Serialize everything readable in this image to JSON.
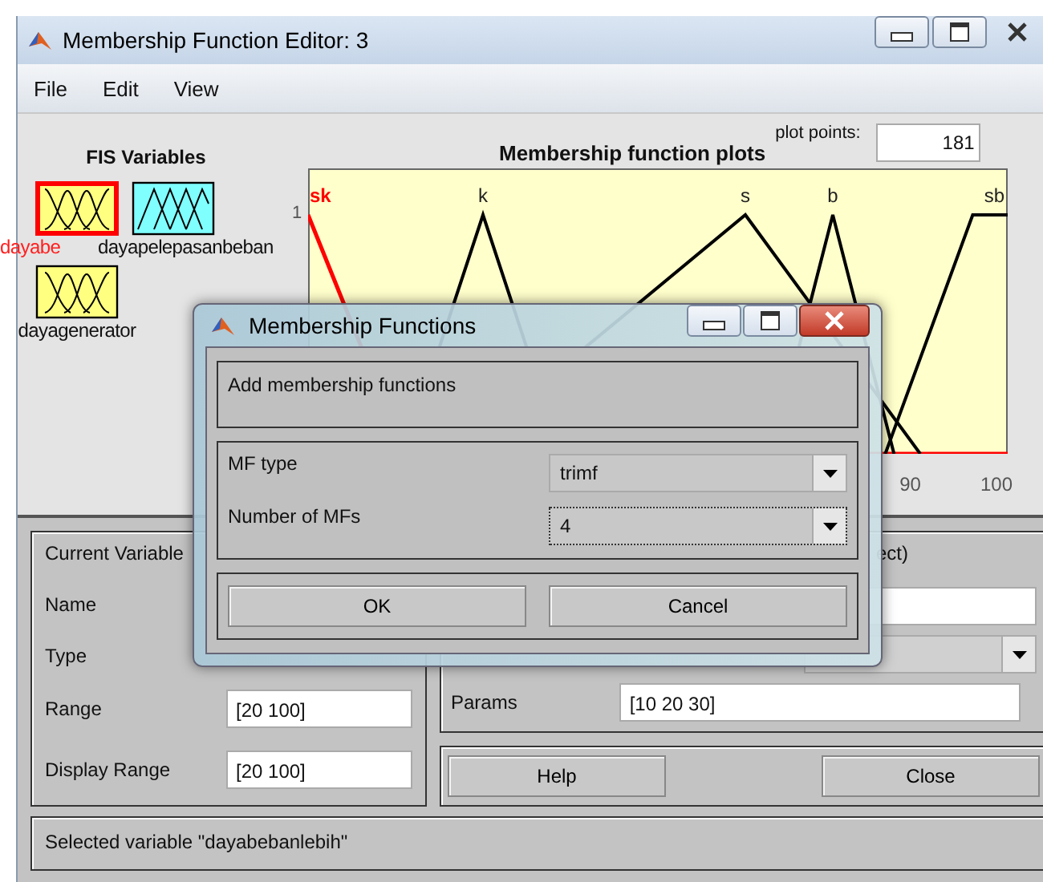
{
  "window": {
    "title": "Membership Function Editor: 3"
  },
  "menu": [
    "File",
    "Edit",
    "View"
  ],
  "fis_variables": {
    "title": "FIS Variables",
    "items": [
      {
        "name": "dayabe",
        "kind": "input",
        "selected": true
      },
      {
        "name": "dayapelepasanbeban",
        "kind": "output",
        "selected": false
      },
      {
        "name": "dayagenerator",
        "kind": "input",
        "selected": false
      }
    ]
  },
  "plot": {
    "title": "Membership function plots",
    "plot_points_label": "plot points:",
    "plot_points": "181",
    "y_tick": "1",
    "x_ticks": [
      "90",
      "100"
    ],
    "mfs": [
      {
        "name": "sk",
        "selected": true
      },
      {
        "name": "k",
        "selected": false
      },
      {
        "name": "s",
        "selected": false
      },
      {
        "name": "b",
        "selected": false
      },
      {
        "name": "sb",
        "selected": false
      }
    ]
  },
  "current_variable": {
    "title": "Current Variable",
    "name_label": "Name",
    "type_label": "Type",
    "range_label": "Range",
    "range": "[20 100]",
    "display_range_label": "Display Range",
    "display_range": "[20 100]"
  },
  "current_mf": {
    "title_fragment": "ect)",
    "params_label": "Params",
    "params": "[10 20 30]"
  },
  "buttons": [
    "Help",
    "Close"
  ],
  "status": "Selected variable \"dayabebanlebih\"",
  "dialog": {
    "title": "Membership Functions",
    "heading": "Add membership functions",
    "mf_type_label": "MF type",
    "mf_type": "trimf",
    "count_label": "Number of MFs",
    "count": "4",
    "buttons": [
      "OK",
      "Cancel"
    ]
  }
}
